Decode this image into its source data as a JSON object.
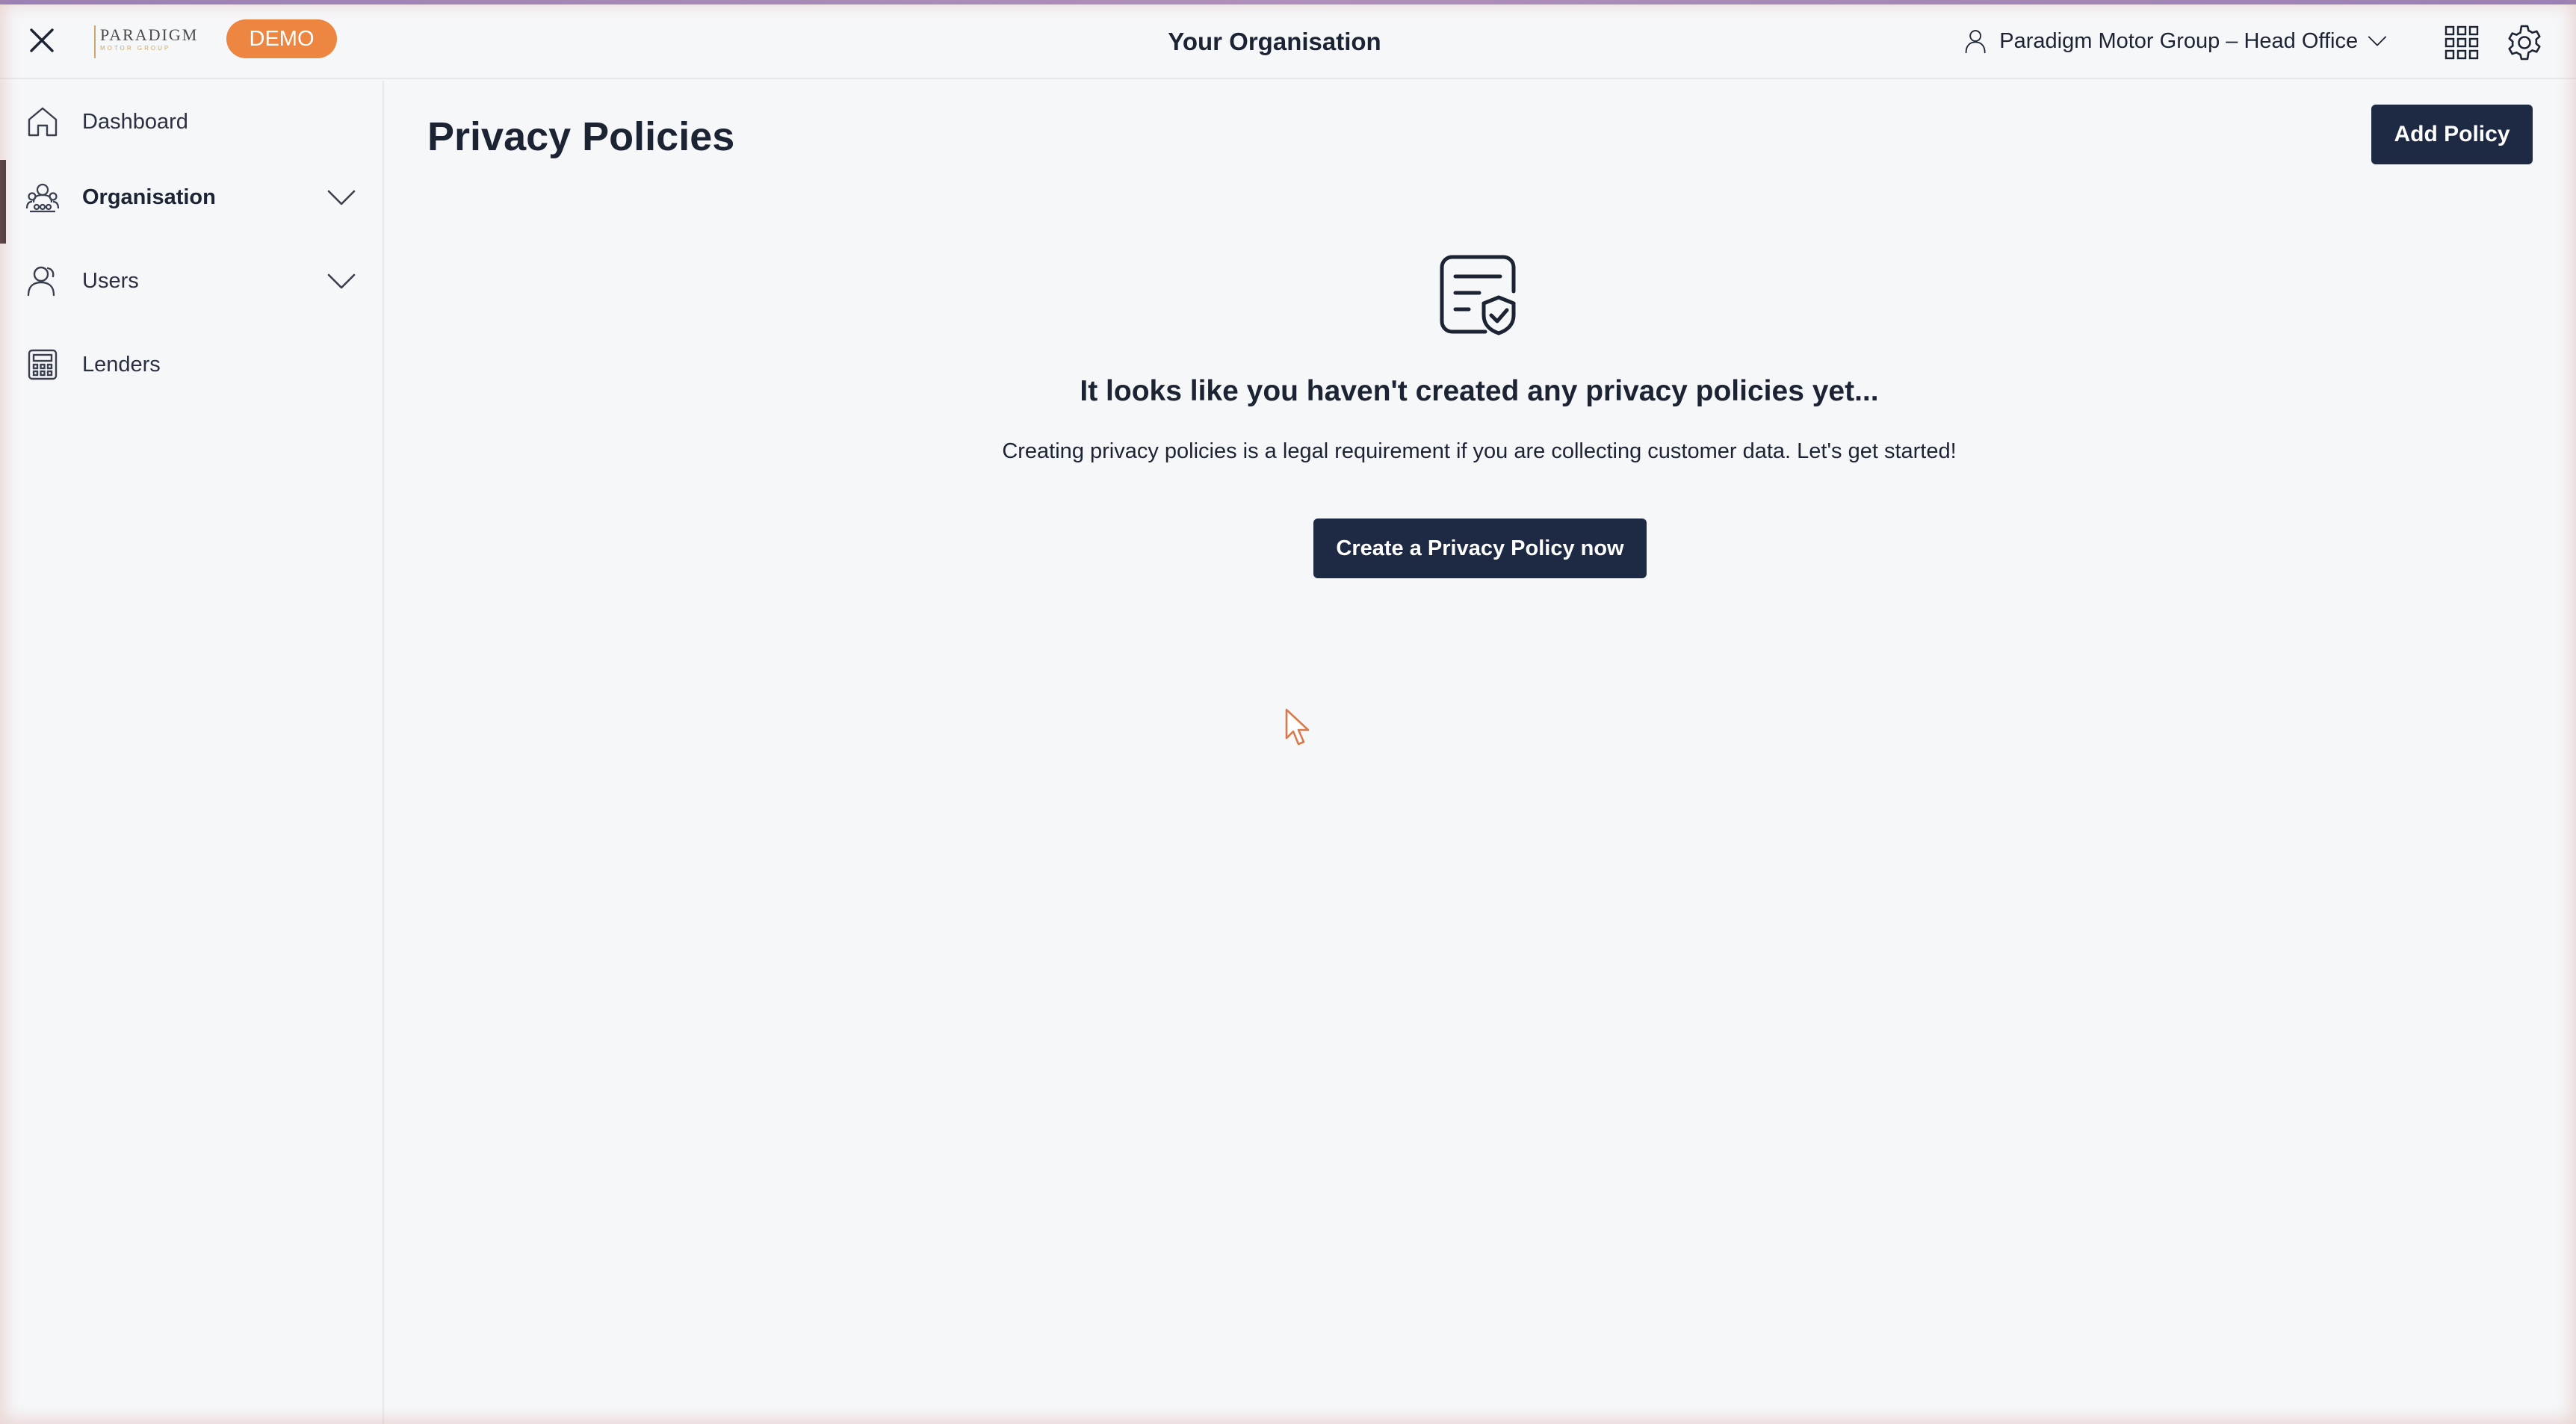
{
  "header": {
    "title": "Your Organisation",
    "logo": {
      "main": "PARADIGM",
      "sub": "MOTOR GROUP"
    },
    "badge": "DEMO",
    "org_switcher": "Paradigm Motor Group – Head Office",
    "icons": {
      "close": "close-icon",
      "user": "user-icon",
      "chevron": "chevron-down-icon",
      "apps": "apps-grid-icon",
      "settings": "gear-icon"
    }
  },
  "sidebar": {
    "items": [
      {
        "label": "Dashboard",
        "icon": "home-icon",
        "expandable": false,
        "active": false
      },
      {
        "label": "Organisation",
        "icon": "organisation-icon",
        "expandable": true,
        "active": true
      },
      {
        "label": "Users",
        "icon": "users-icon",
        "expandable": true,
        "active": false
      },
      {
        "label": "Lenders",
        "icon": "calculator-icon",
        "expandable": false,
        "active": false
      }
    ]
  },
  "main": {
    "title": "Privacy Policies",
    "add_button": "Add Policy",
    "empty_state": {
      "icon": "policy-document-shield-icon",
      "heading": "It looks like you haven't created any privacy policies yet...",
      "text": "Creating privacy policies is a legal requirement if you are collecting customer data. Let's get started!",
      "cta": "Create a Privacy Policy now"
    }
  },
  "colors": {
    "primary_button": "#1e2a44",
    "demo_badge": "#ec8640",
    "background": "#f6f7f9",
    "active_indicator": "#3d2f33"
  }
}
